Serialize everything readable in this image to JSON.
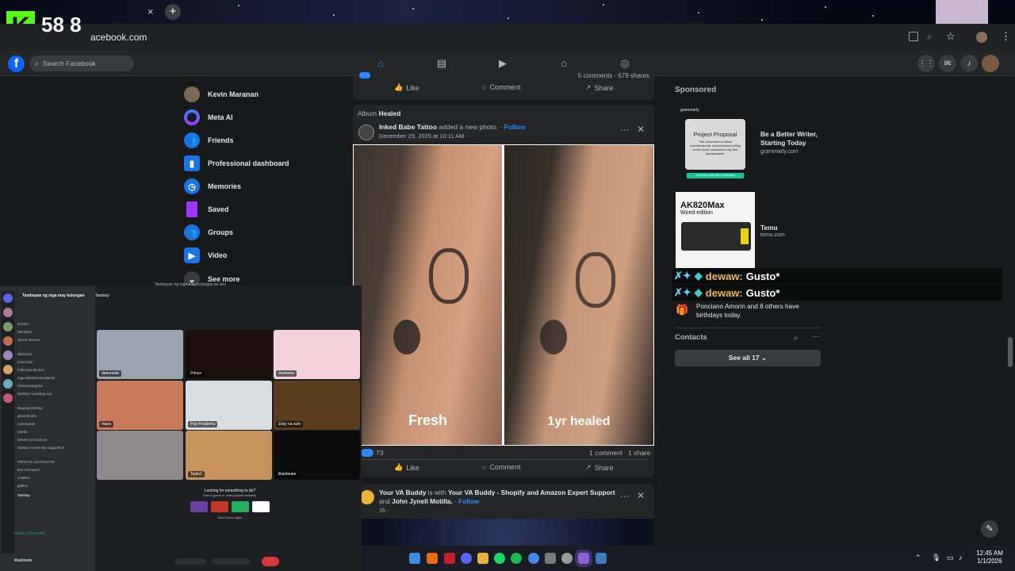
{
  "browser": {
    "url": "acebook.com",
    "tab_close": "×",
    "new_tab": "+"
  },
  "overlay": {
    "badge": "K",
    "counter": "58 8"
  },
  "fb": {
    "search_placeholder": "Search Facebook",
    "sidebar": [
      {
        "label": "Kevin Maranan",
        "icon": "avatar"
      },
      {
        "label": "Meta AI",
        "icon": "meta-ai-icon"
      },
      {
        "label": "Friends",
        "icon": "friends-icon"
      },
      {
        "label": "Professional dashboard",
        "icon": "dashboard-icon"
      },
      {
        "label": "Memories",
        "icon": "memories-icon"
      },
      {
        "label": "Saved",
        "icon": "saved-icon"
      },
      {
        "label": "Groups",
        "icon": "groups-icon"
      },
      {
        "label": "Video",
        "icon": "video-icon"
      },
      {
        "label": "See more",
        "icon": "chevron-down-icon"
      }
    ],
    "prev_post": {
      "counts": "5 comments · 679 shares",
      "like": "Like",
      "comment": "Comment",
      "share": "Share"
    },
    "post": {
      "album_prefix": "Album",
      "album_name": "Healed",
      "author": "Inked Babe Tattoo",
      "action": "added a new photo.",
      "follow": "Follow",
      "date": "December 29, 2025 at 10:11 AM ·",
      "img_left_label": "Fresh",
      "img_right_label": "1yr healed",
      "reactions": "73",
      "comments": "1 comment",
      "shares": "1 share",
      "like": "Like",
      "comment": "Comment",
      "share": "Share"
    },
    "post2": {
      "author": "Your VA Buddy",
      "is_with": "is with",
      "with_name": "Your VA Buddy - Shopify and Amazon Expert Support",
      "and": "and",
      "person": "John Jynell Motilla.",
      "follow": "Follow",
      "time": "1h ·"
    },
    "sponsored": {
      "heading": "Sponsored",
      "ads": [
        {
          "brand": "grammarly",
          "card_title": "Project Proposal",
          "card_text": "This document contains unprofessional, unconvincing writing which some coworkers may find questionable.",
          "cta": "Do better work with Grammarly",
          "title": "Be a Better Writer, Starting Today",
          "domain": "grammarly.com"
        },
        {
          "card_title": "AK820Max",
          "card_sub": "Wired edition",
          "title": "Temu",
          "domain": "temu.com"
        }
      ]
    },
    "birthdays": {
      "text": "Ponciano Amorin and 8 others have birthdays today."
    },
    "contacts": {
      "heading": "Contacts",
      "see_all": "See all 17"
    }
  },
  "chat": [
    {
      "user": "dewaw:",
      "msg": "Gusto*"
    },
    {
      "user": "dewaw:",
      "msg": "Gusto*"
    }
  ],
  "discord": {
    "server": "Tambayan ng mga may kulungan",
    "call_title": "Tambayan ng mga may kulungan sa ano",
    "voice_channel": "Tambay",
    "channels": [
      "Events",
      "Members",
      "Server Boosts",
      "Welcome",
      "mod-chat",
      "hello-bye-bitches",
      "mga-deleted-na-talamis",
      "chismosang-bot",
      "tambay-n-tambay-out",
      "Bagong tambay",
      "general-tofu",
      "commands",
      "media",
      "stream-promotions",
      "tambay-movie-trip-suggestion",
      "PRIVATE CHATCHATS",
      "bot-command",
      "chatbox",
      "gallery",
      "Tambay"
    ],
    "tiles": [
      "darkmode",
      "Prince",
      "dunkwea",
      "mace",
      "Pop Problems",
      "Elsiy na sufe",
      "",
      "Teplo1",
      "lilianbeats"
    ],
    "prompt_title": "Looking for something to do?",
    "prompt_sub": "Start a game or video playlist instantly.",
    "dont_show": "Don't show again",
    "status": "Video Connected",
    "user": "lilianbeats"
  },
  "taskbar": {
    "time": "12:45 AM",
    "date": "1/1/2026"
  }
}
